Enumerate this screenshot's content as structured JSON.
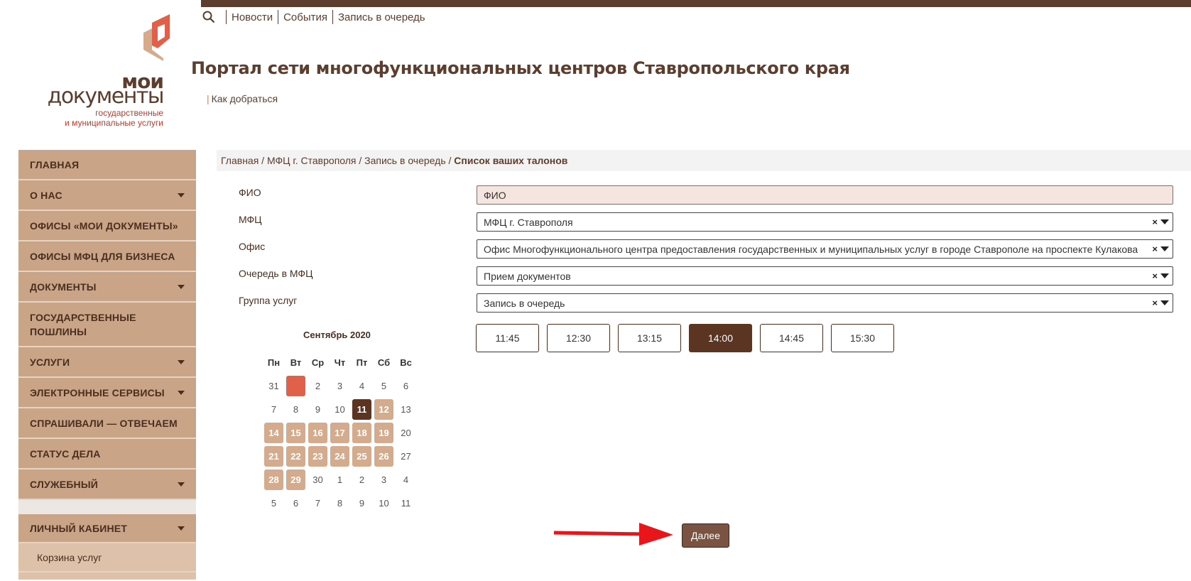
{
  "topnav": {
    "items": [
      "Новости",
      "События",
      "Запись в очередь"
    ]
  },
  "logo": {
    "line1": "мои",
    "line2": "документы",
    "line3": "государственные",
    "line4": "и муниципальные услуги"
  },
  "header": {
    "title": "Портал сети многофункциональных центров Ставропольского края",
    "how_to_get": "Как добраться"
  },
  "sidebar": {
    "items": [
      {
        "label": "ГЛАВНАЯ"
      },
      {
        "label": "О НАС"
      },
      {
        "label": "ОФИСЫ «МОИ ДОКУМЕНТЫ»"
      },
      {
        "label": "ОФИСЫ МФЦ ДЛЯ БИЗНЕСА"
      },
      {
        "label": "ДОКУМЕНТЫ"
      },
      {
        "label": "ГОСУДАРСТВЕННЫЕ ПОШЛИНЫ"
      },
      {
        "label": "УСЛУГИ"
      },
      {
        "label": "ЭЛЕКТРОННЫЕ СЕРВИСЫ"
      },
      {
        "label": "СПРАШИВАЛИ — ОТВЕЧАЕМ"
      },
      {
        "label": "СТАТУС ДЕЛА"
      },
      {
        "label": "СЛУЖЕБНЫЙ"
      }
    ],
    "account": "ЛИЧНЫЙ КАБИНЕТ",
    "account_sub": "Корзина услуг"
  },
  "breadcrumb": {
    "path": "Главная / МФЦ г. Ставрополя / Запись в очередь / ",
    "current": "Список ваших талонов"
  },
  "form": {
    "fio_label": "ФИО",
    "fio_value": "ФИО",
    "mfc_label": "МФЦ",
    "mfc_value": "МФЦ г. Ставрополя",
    "office_label": "Офис",
    "office_value": "Офис Многофункционального центра предоставления государственных и муниципальных услуг в городе Ставрополе на проспекте Кулакова",
    "queue_label": "Очередь в МФЦ",
    "queue_value": "Прием документов",
    "group_label": "Группа услуг",
    "group_value": "Запись в очередь",
    "clear_symbol": "×"
  },
  "calendar": {
    "title": "Сентябрь 2020",
    "weekdays": [
      "Пн",
      "Вт",
      "Ср",
      "Чт",
      "Пт",
      "Сб",
      "Вс"
    ],
    "weeks": [
      [
        {
          "d": "31",
          "s": "muted"
        },
        {
          "d": "1",
          "s": "today"
        },
        {
          "d": "2",
          "s": "muted"
        },
        {
          "d": "3",
          "s": "muted"
        },
        {
          "d": "4",
          "s": "muted"
        },
        {
          "d": "5",
          "s": "muted"
        },
        {
          "d": "6",
          "s": "muted"
        }
      ],
      [
        {
          "d": "7",
          "s": "muted"
        },
        {
          "d": "8",
          "s": "muted"
        },
        {
          "d": "9",
          "s": "muted"
        },
        {
          "d": "10",
          "s": "muted"
        },
        {
          "d": "11",
          "s": "sel"
        },
        {
          "d": "12",
          "s": "avail"
        },
        {
          "d": "13",
          "s": "muted"
        }
      ],
      [
        {
          "d": "14",
          "s": "avail"
        },
        {
          "d": "15",
          "s": "avail"
        },
        {
          "d": "16",
          "s": "avail"
        },
        {
          "d": "17",
          "s": "avail"
        },
        {
          "d": "18",
          "s": "avail"
        },
        {
          "d": "19",
          "s": "avail"
        },
        {
          "d": "20",
          "s": "muted"
        }
      ],
      [
        {
          "d": "21",
          "s": "avail"
        },
        {
          "d": "22",
          "s": "avail"
        },
        {
          "d": "23",
          "s": "avail"
        },
        {
          "d": "24",
          "s": "avail"
        },
        {
          "d": "25",
          "s": "avail"
        },
        {
          "d": "26",
          "s": "avail"
        },
        {
          "d": "27",
          "s": "muted"
        }
      ],
      [
        {
          "d": "28",
          "s": "avail"
        },
        {
          "d": "29",
          "s": "avail"
        },
        {
          "d": "30",
          "s": "muted"
        },
        {
          "d": "1",
          "s": "muted"
        },
        {
          "d": "2",
          "s": "muted"
        },
        {
          "d": "3",
          "s": "muted"
        },
        {
          "d": "4",
          "s": "muted"
        }
      ],
      [
        {
          "d": "5",
          "s": "muted"
        },
        {
          "d": "6",
          "s": "muted"
        },
        {
          "d": "7",
          "s": "muted"
        },
        {
          "d": "8",
          "s": "muted"
        },
        {
          "d": "9",
          "s": "muted"
        },
        {
          "d": "10",
          "s": "muted"
        },
        {
          "d": "11",
          "s": "muted"
        }
      ]
    ]
  },
  "slots": {
    "times": [
      "11:45",
      "12:30",
      "13:15",
      "14:00",
      "14:45",
      "15:30"
    ],
    "selected_index": 3
  },
  "actions": {
    "next_label": "Далее"
  },
  "colors": {
    "brand_brown": "#5c3d2e",
    "sidebar_bg": "#c9a486",
    "available_day": "#d4ab8c",
    "selected": "#5c3422",
    "today": "#e0604a",
    "arrow": "#e8161b"
  }
}
